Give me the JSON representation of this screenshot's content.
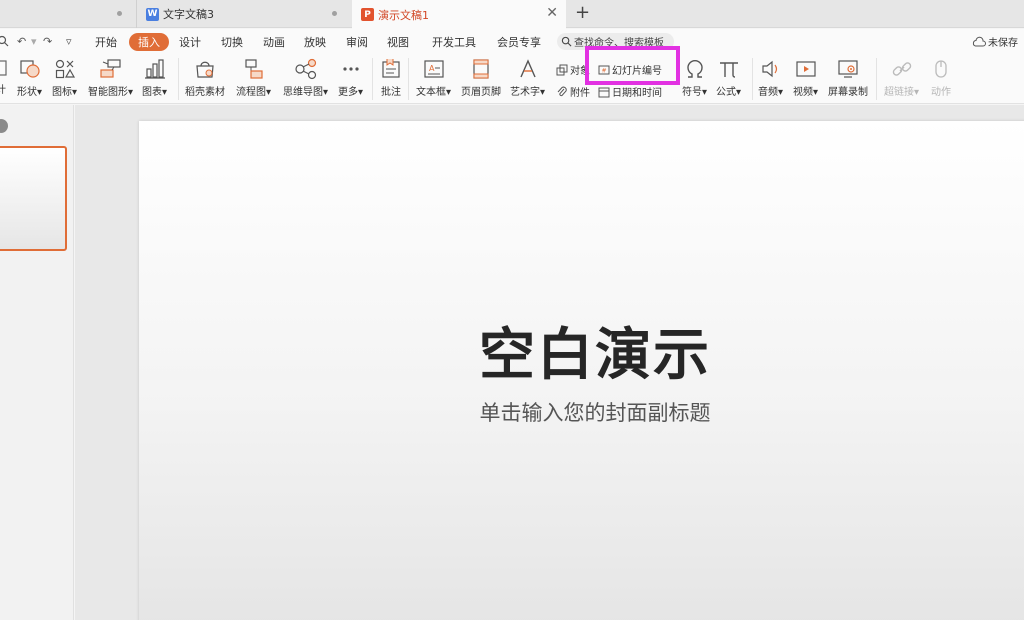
{
  "tabs": [
    {
      "label": "文字文稿3",
      "icon": "W",
      "icon_color": "#4a7fe0"
    },
    {
      "label": "演示文稿1",
      "icon": "P",
      "icon_color": "#e2532e"
    }
  ],
  "menu": {
    "quick_access": [
      "↶",
      "↷"
    ],
    "items": [
      "开始",
      "插入",
      "设计",
      "切换",
      "动画",
      "放映",
      "审阅",
      "视图",
      "开发工具",
      "会员专享"
    ],
    "active": "插入",
    "search_placeholder": "查找命令、搜索模板",
    "unsaved": "未保存"
  },
  "ribbon": {
    "partial_label": "计",
    "shape": "形状",
    "icon_lib": "图标",
    "smart_art": "智能图形",
    "chart": "图表",
    "straw_material": "稻壳素材",
    "flowchart": "流程图",
    "mindmap": "思维导图",
    "more": "更多",
    "comment": "批注",
    "textbox": "文本框",
    "header_footer": "页眉页脚",
    "wordart": "艺术字",
    "object": "对象",
    "slide_number": "幻灯片编号",
    "attachment": "附件",
    "date_time": "日期和时间",
    "symbol": "符号",
    "formula": "公式",
    "audio": "音频",
    "video": "视频",
    "screen_record": "屏幕录制",
    "hyperlink": "超链接",
    "action": "动作"
  },
  "slide": {
    "title": "空白演示",
    "subtitle": "单击输入您的封面副标题"
  },
  "colors": {
    "accent": "#e06d37",
    "highlight": "#e231e2"
  }
}
